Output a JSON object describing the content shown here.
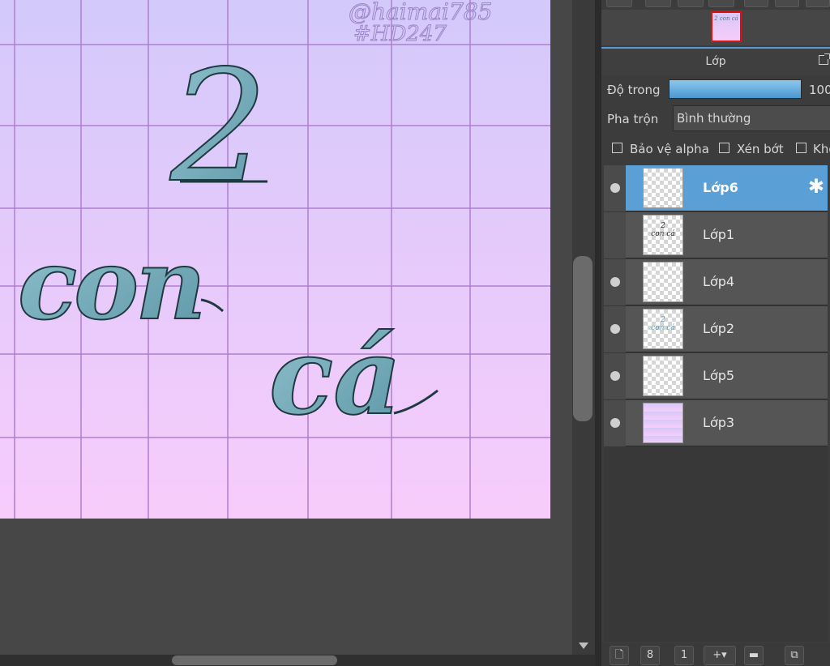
{
  "canvas": {
    "text_number": "2",
    "text_word1": "con",
    "text_word2": "cá",
    "signature_line1": "@haimai785",
    "signature_line2": "#HD247",
    "gradient_top": "#d3c9fb",
    "gradient_bottom": "#f7ccfb",
    "grid_color": "#b07ed0",
    "letter_color": "#6fa8b8"
  },
  "navigator": {
    "thumb_text": "2 con cá"
  },
  "layer_panel": {
    "title": "Lớp",
    "opacity_label": "Độ trong",
    "opacity_value": "100",
    "blend_label": "Pha trộn",
    "blend_value": "Bình thường",
    "checkboxes": [
      "Bảo vệ alpha",
      "Xén bớt",
      "Kho"
    ],
    "layers": [
      {
        "name": "Lớp6",
        "selected": true,
        "visible": true
      },
      {
        "name": "Lớp1",
        "selected": false,
        "visible": false
      },
      {
        "name": "Lớp4",
        "selected": false,
        "visible": true
      },
      {
        "name": "Lớp2",
        "selected": false,
        "visible": true
      },
      {
        "name": "Lớp5",
        "selected": false,
        "visible": true
      },
      {
        "name": "Lớp3",
        "selected": false,
        "visible": true
      }
    ],
    "bottom_buttons": [
      {
        "icon": "new-page-icon",
        "glyph": "🗋"
      },
      {
        "icon": "layer-8bit-icon",
        "glyph": "8"
      },
      {
        "icon": "layer-1bit-icon",
        "glyph": "1"
      },
      {
        "icon": "add-layer-dropdown-icon",
        "glyph": "+▾"
      },
      {
        "icon": "folder-icon",
        "glyph": "▬"
      },
      {
        "icon": "duplicate-layer-icon",
        "glyph": "⧉"
      }
    ],
    "accent": "#5a9fd6"
  }
}
